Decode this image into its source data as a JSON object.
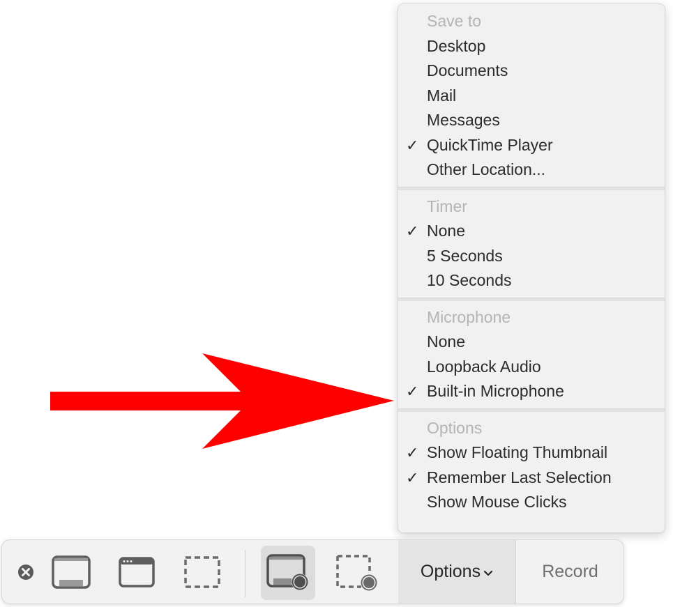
{
  "menu": {
    "sections": [
      {
        "header": "Save to",
        "items": [
          {
            "label": "Desktop",
            "checked": false
          },
          {
            "label": "Documents",
            "checked": false
          },
          {
            "label": "Mail",
            "checked": false
          },
          {
            "label": "Messages",
            "checked": false
          },
          {
            "label": "QuickTime Player",
            "checked": true
          },
          {
            "label": "Other Location...",
            "checked": false
          }
        ]
      },
      {
        "header": "Timer",
        "items": [
          {
            "label": "None",
            "checked": true
          },
          {
            "label": "5 Seconds",
            "checked": false
          },
          {
            "label": "10 Seconds",
            "checked": false
          }
        ]
      },
      {
        "header": "Microphone",
        "items": [
          {
            "label": "None",
            "checked": false
          },
          {
            "label": "Loopback Audio",
            "checked": false
          },
          {
            "label": "Built-in Microphone",
            "checked": true
          }
        ]
      },
      {
        "header": "Options",
        "items": [
          {
            "label": "Show Floating Thumbnail",
            "checked": true
          },
          {
            "label": "Remember Last Selection",
            "checked": true
          },
          {
            "label": "Show Mouse Clicks",
            "checked": false
          }
        ]
      }
    ],
    "check_glyph": "✓"
  },
  "toolbar": {
    "options_label": "Options",
    "options_chevron": "⌄",
    "record_label": "Record",
    "selected_tool": "record-entire-screen"
  },
  "annotation": {
    "arrow_color": "#ff0000",
    "points_to": "Built-in Microphone"
  },
  "colors": {
    "menu_bg": "#f1f1f1",
    "header_text": "#b4b4b4",
    "item_text": "#2b2b2b",
    "toolbar_bg": "#f2f2f2"
  }
}
